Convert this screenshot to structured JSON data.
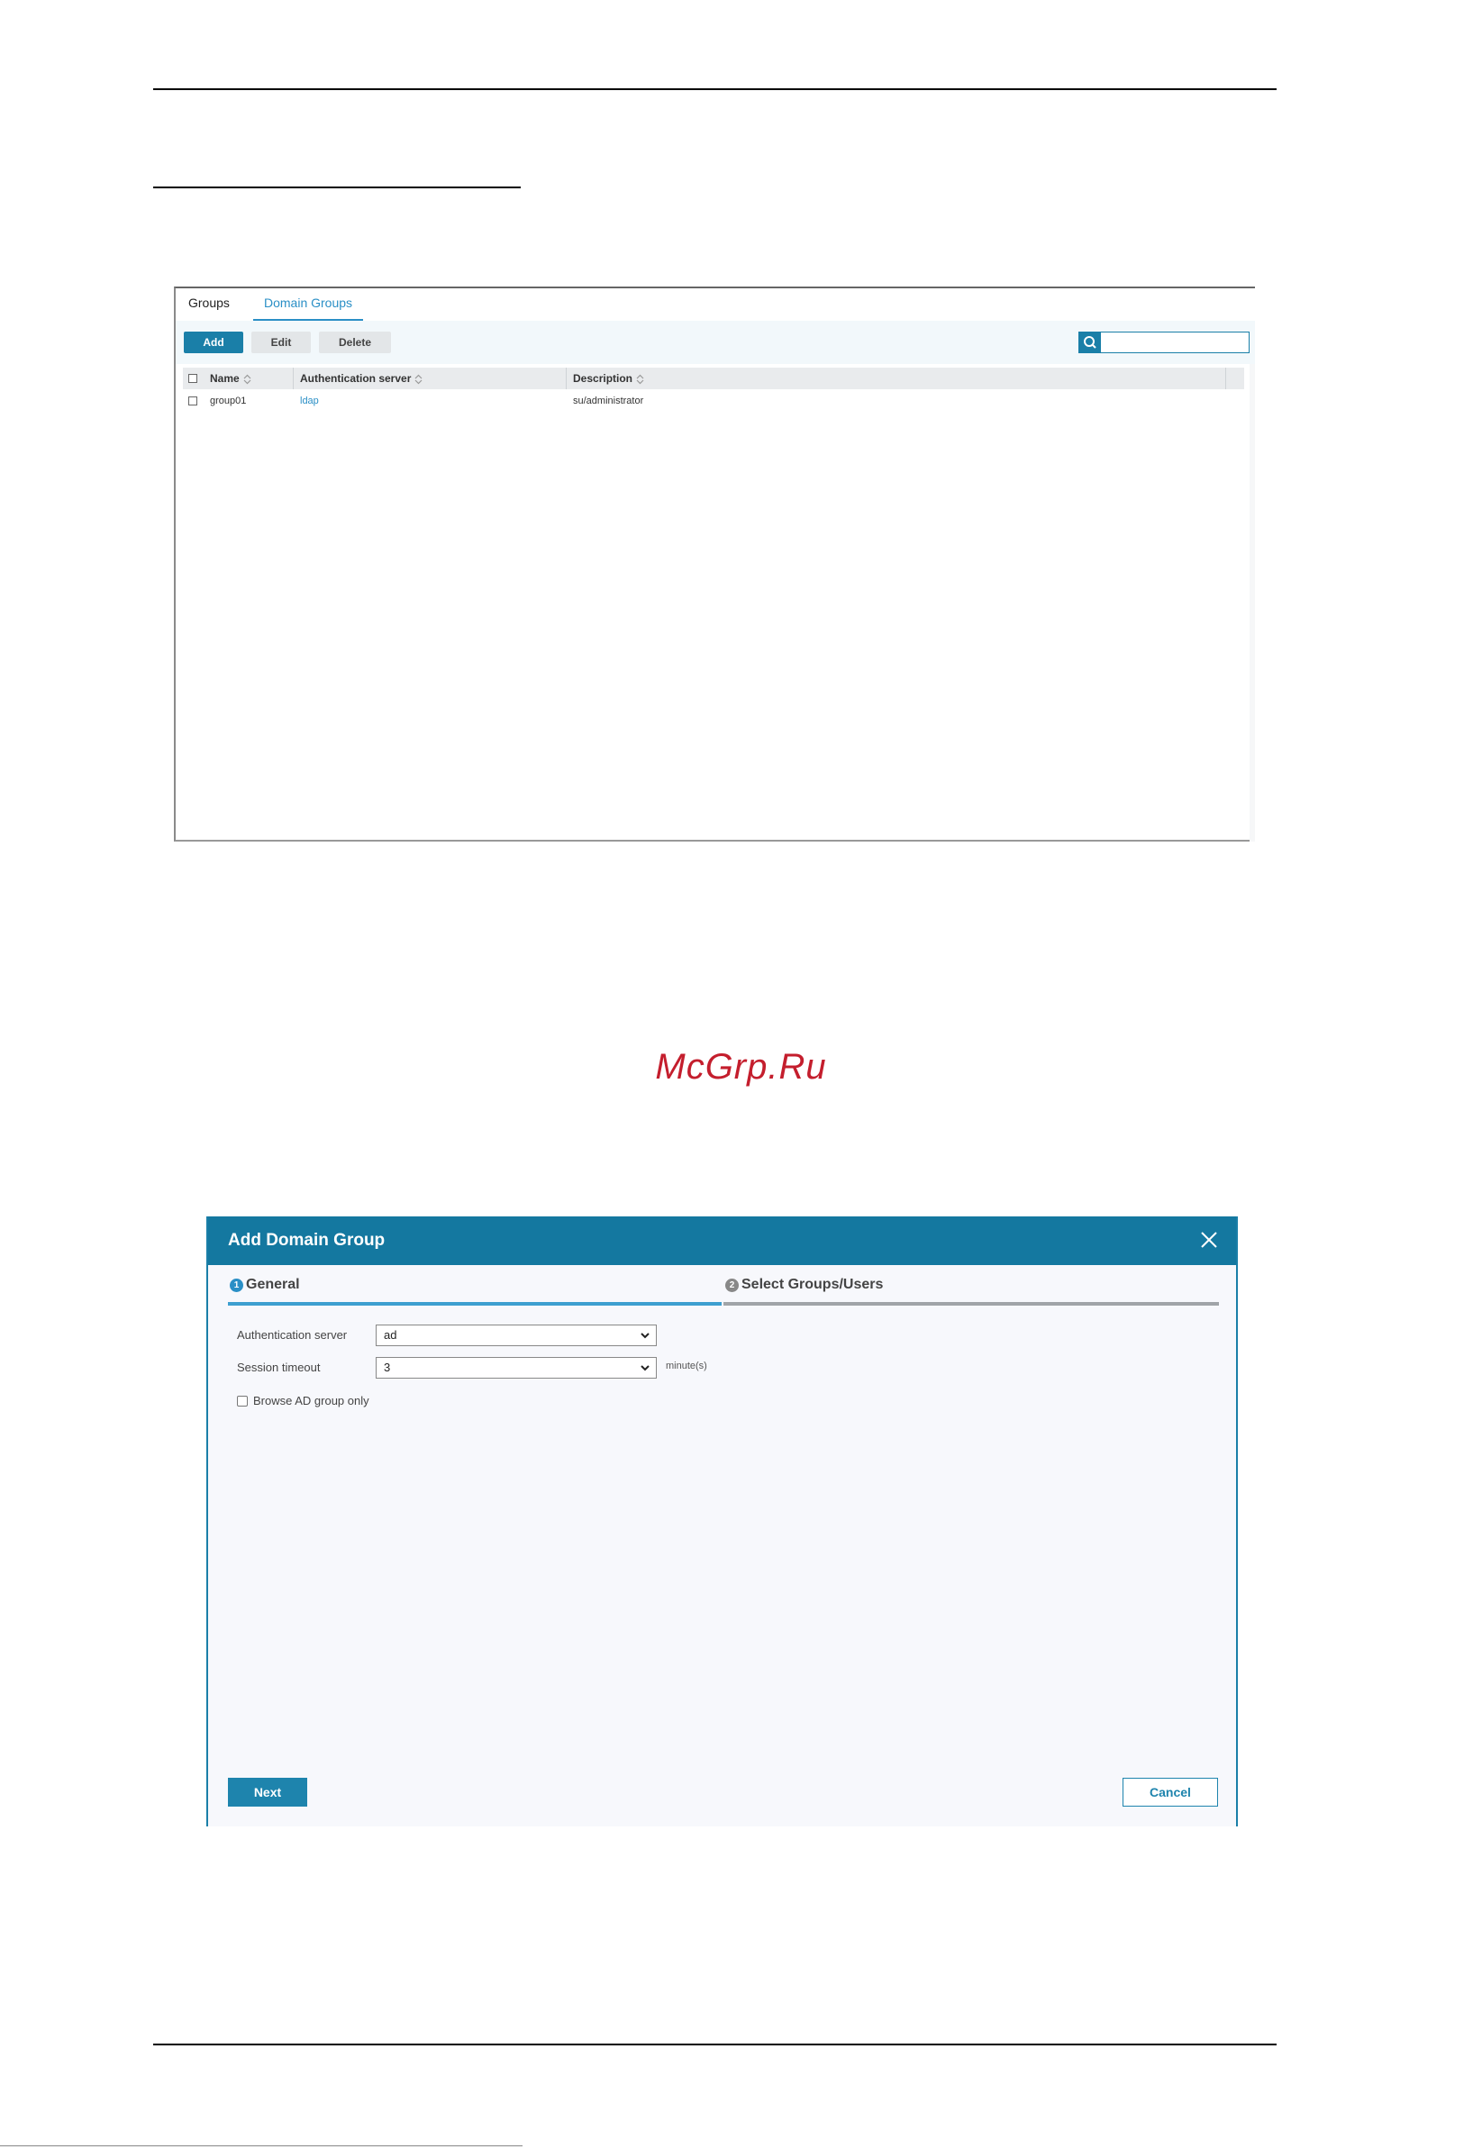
{
  "groups_panel": {
    "tabs": [
      {
        "label": "Groups"
      },
      {
        "label": "Domain Groups"
      }
    ],
    "toolbar": {
      "add_label": "Add",
      "edit_label": "Edit",
      "delete_label": "Delete",
      "search_value": ""
    },
    "table": {
      "columns": [
        "Name",
        "Authentication server",
        "Description"
      ],
      "rows": [
        {
          "name": "group01",
          "auth_server": "ldap",
          "description": "su/administrator"
        }
      ]
    }
  },
  "watermark": {
    "text": "McGrp.Ru",
    "color": "#c41e2d"
  },
  "add_domain_group_dialog": {
    "title": "Add Domain Group",
    "steps": [
      {
        "number": "1",
        "label": "General"
      },
      {
        "number": "2",
        "label": "Select Groups/Users"
      }
    ],
    "fields": {
      "auth_server_label": "Authentication server",
      "auth_server_value": "ad",
      "session_timeout_label": "Session timeout",
      "session_timeout_value": "3",
      "session_timeout_unit": "minute(s)",
      "browse_ad_label": "Browse AD group only",
      "browse_ad_checked": false
    },
    "buttons": {
      "next_label": "Next",
      "cancel_label": "Cancel"
    }
  },
  "colors": {
    "accent": "#1478a0",
    "link": "#2a8fc6"
  }
}
